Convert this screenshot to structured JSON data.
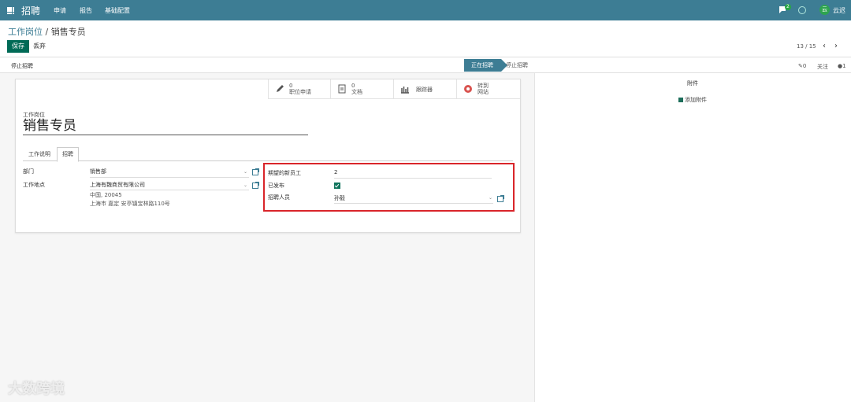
{
  "topbar": {
    "app_title": "招聘",
    "menu": [
      "申请",
      "报告",
      "基础配置"
    ],
    "message_count": "2",
    "avatar_initial": "云",
    "username": "云迟"
  },
  "breadcrumb": {
    "parent": "工作岗位",
    "separator": " / ",
    "current": "销售专员"
  },
  "control": {
    "save_label": "保存",
    "discard_label": "丢弃",
    "pager": "13 / 15"
  },
  "statusbar": {
    "stop_button": "停止招聘",
    "stage_active": "正在招聘",
    "stage_other": "停止招聘"
  },
  "chatter": {
    "attachment_count": "0",
    "follow_label": "关注",
    "follower_count": "1",
    "attachments_title": "附件",
    "add_attachment": "添加附件"
  },
  "smart_buttons": {
    "applications_count": "0",
    "applications_label": "职位申请",
    "documents_count": "0",
    "documents_label": "文档",
    "tracker_label": "跟踪器",
    "website_l1": "转到",
    "website_l2": "网站"
  },
  "form": {
    "name_label": "工作岗位",
    "name_value": "销售专员",
    "tabs": [
      "工作说明",
      "招聘"
    ],
    "department_label": "部门",
    "department_value": "销售部",
    "location_label": "工作地点",
    "location_value": "上海有魏商贸有限公司",
    "address_line1": "中国, 20045",
    "address_line2": "上海市 嘉定 安亭镇宝林路110号",
    "expected_label": "期望的新员工",
    "expected_value": "2",
    "published_label": "已发布",
    "recruiter_label": "招聘人员",
    "recruiter_value": "孙毅"
  },
  "watermark": "大数跨境",
  "colors": {
    "topbar": "#3d7d94",
    "primary": "#006a56",
    "highlight": "#d9252a"
  }
}
